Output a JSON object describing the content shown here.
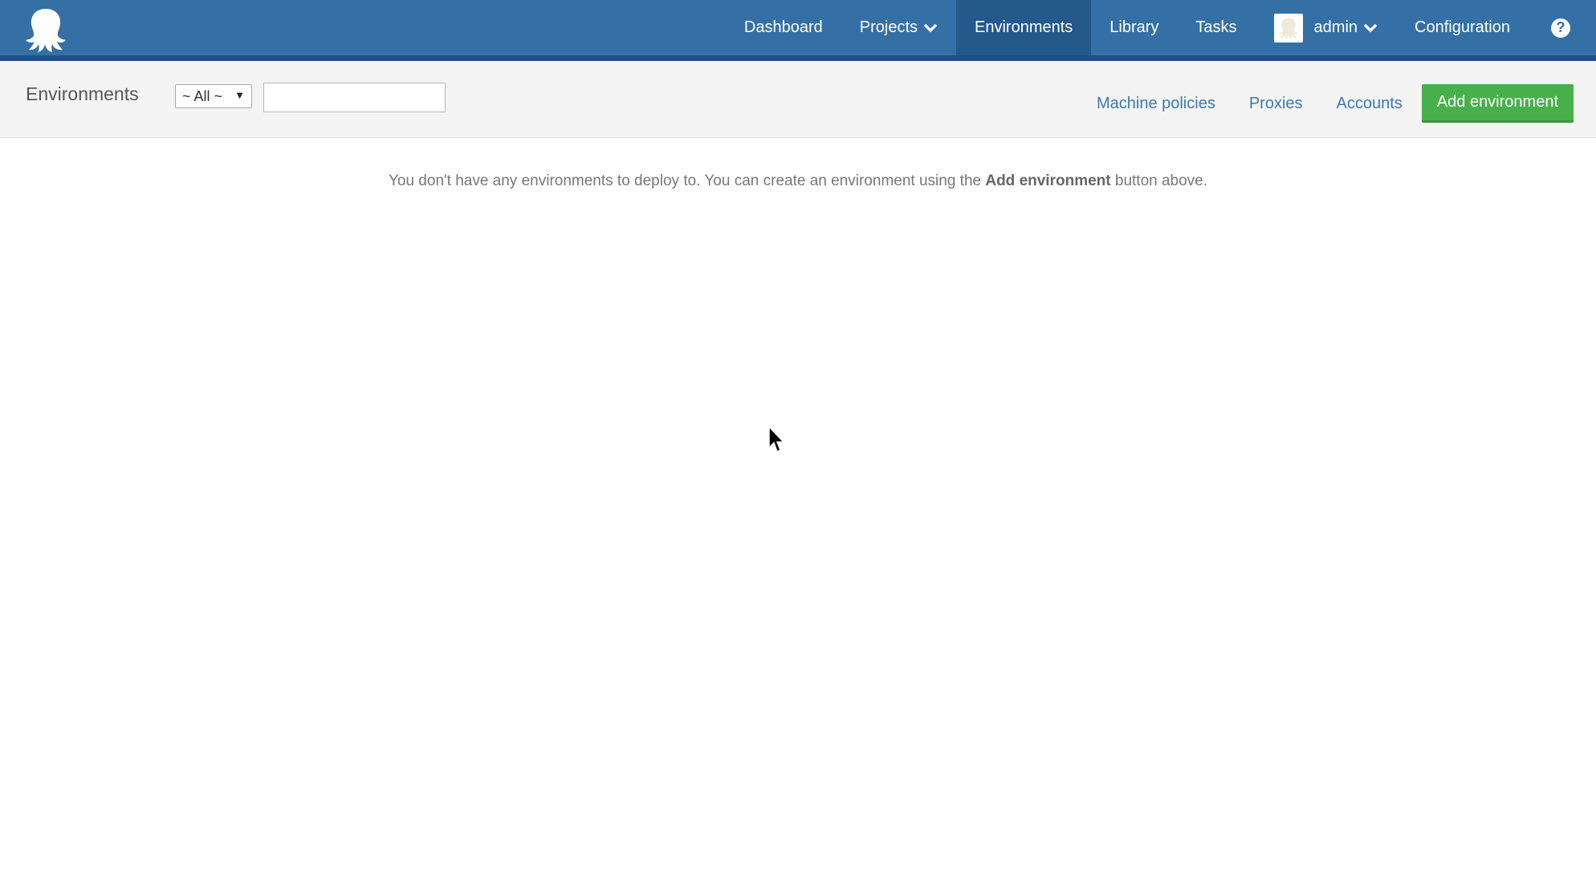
{
  "app": {
    "logo_icon": "octopus-logo-icon"
  },
  "nav": {
    "items": [
      {
        "label": "Dashboard"
      },
      {
        "label": "Projects",
        "has_dropdown": true
      },
      {
        "label": "Environments",
        "active": true
      },
      {
        "label": "Library"
      },
      {
        "label": "Tasks"
      }
    ],
    "user": {
      "name": "admin",
      "avatar_icon": "avatar-icon"
    },
    "configuration_label": "Configuration",
    "help_icon": "help-icon",
    "help_glyph": "?"
  },
  "toolbar": {
    "title": "Environments",
    "filter": {
      "selected": "~ All ~"
    },
    "search": {
      "value": "",
      "placeholder": ""
    },
    "links": {
      "machine_policies": "Machine policies",
      "proxies": "Proxies",
      "accounts": "Accounts"
    },
    "add_button": "Add environment"
  },
  "main": {
    "empty_message": {
      "prefix": "You don't have any environments to deploy to. You can create an environment using the",
      "bold": "Add environment",
      "suffix": "button above."
    }
  },
  "colors": {
    "nav_bg": "#3470a6",
    "nav_active": "#24598c",
    "link": "#3a79b3",
    "primary_button": "#47b04b"
  }
}
